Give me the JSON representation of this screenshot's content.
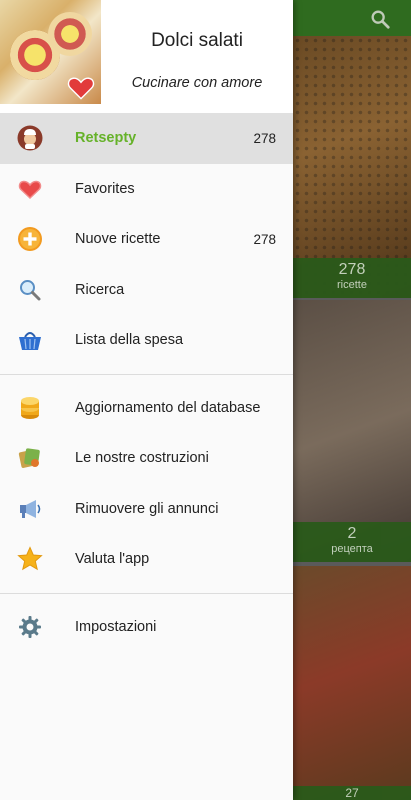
{
  "header": {
    "title": "Dolci salati",
    "subtitle": "Cucinare con amore"
  },
  "menu_primary": [
    {
      "label": "Retsepty",
      "count": "278",
      "icon": "chef-avatar-icon",
      "active": true
    },
    {
      "label": "Favorites",
      "count": "",
      "icon": "heart-icon"
    },
    {
      "label": "Nuove ricette",
      "count": "278",
      "icon": "plus-circle-icon"
    },
    {
      "label": "Ricerca",
      "count": "",
      "icon": "magnifier-icon"
    },
    {
      "label": "Lista della spesa",
      "count": "",
      "icon": "basket-icon"
    }
  ],
  "menu_secondary": [
    {
      "label": "Aggiornamento del database",
      "icon": "database-icon"
    },
    {
      "label": "Le nostre costruzioni",
      "icon": "apps-icon"
    },
    {
      "label": "Rimuovere gli annunci",
      "icon": "megaphone-icon"
    },
    {
      "label": "Valuta l'app",
      "icon": "star-icon"
    }
  ],
  "menu_tertiary": [
    {
      "label": "Impostazioni",
      "icon": "gear-icon"
    }
  ],
  "background_cards": [
    {
      "count": "278",
      "caption": "ricette"
    },
    {
      "count": "2",
      "caption": "рецепта"
    },
    {
      "count": "27",
      "caption": ""
    }
  ],
  "colors": {
    "accent_green": "#66b22a",
    "topbar_green": "#2f6b1f",
    "active_row": "#e0e0e0"
  }
}
